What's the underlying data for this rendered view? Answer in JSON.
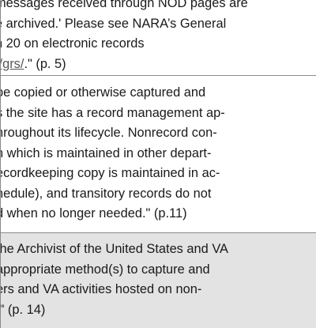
{
  "rows": [
    {
      "lines": [
        "messages received through NOD pages are",
        "e archived.' Please see NARA’s General",
        "n 20 on electronic records",
        "[link]"
      ],
      "link_text": "t/grs/",
      "link_suffix": ".\" (p. 5)"
    },
    {
      "lines": [
        "be copied or otherwise captured and",
        "s the site has a record management ap-",
        "hroughout its lifecycle. Nonrecord con-",
        "n which is maintained in other depart-",
        "ecordkeeping copy is maintained in ac-",
        "hedule), and transitory records do not",
        "d when no longer needed.\" (p.11)"
      ]
    },
    {
      "lines": [
        "the Archivist of the United States and VA",
        "appropriate method(s) to capture and",
        "ers and VA activities hosted on non-",
        ".\" (p. 14)"
      ]
    }
  ]
}
